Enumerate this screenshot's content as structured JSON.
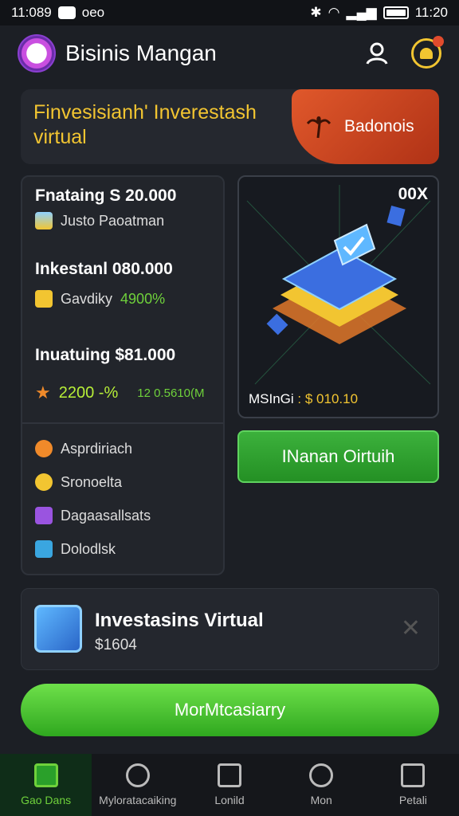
{
  "status": {
    "left_time": "11:089",
    "carrier": "oeo",
    "right_time": "11:20"
  },
  "header": {
    "brand": "Bisinis Mangan"
  },
  "banner": {
    "title": "Finvesisianh' Inverestash virtual",
    "promo_label": "Badonois"
  },
  "stats": [
    {
      "value": "Fnataing S 20.000",
      "sub": "Justo Paoatman"
    },
    {
      "value": "Inkestanl 080.000",
      "sub": "Gavdiky",
      "highlight": "4900%"
    },
    {
      "value": "Inuatuing $81.000",
      "sub_primary": "2200 -%",
      "sub_secondary": "12 0.5610(M"
    }
  ],
  "menu": [
    {
      "label": "Asprdiriach",
      "icon": "flame-icon",
      "color": "#f08a2a"
    },
    {
      "label": "Sronoelta",
      "icon": "coin-icon",
      "color": "#f2c531"
    },
    {
      "label": "Dagaasallsats",
      "icon": "cube-icon",
      "color": "#9a54e0"
    },
    {
      "label": "Dolodlsk",
      "icon": "document-icon",
      "color": "#3aa6e0"
    }
  ],
  "visual": {
    "zoom": "00X",
    "label": "MSInGi",
    "amount": ": $ 010.10"
  },
  "green_button": "INanan Oirtuih",
  "card": {
    "title": "Investasins Virtual",
    "price": "$1604"
  },
  "main_button": "MorMtcasiarry",
  "nav": [
    {
      "label": "Gao Dans",
      "icon": "home-icon"
    },
    {
      "label": "Myloratacaiking",
      "icon": "search-icon"
    },
    {
      "label": "Lonild",
      "icon": "close-box-icon"
    },
    {
      "label": "Mon",
      "icon": "search-icon"
    },
    {
      "label": "Petali",
      "icon": "square-icon"
    }
  ]
}
